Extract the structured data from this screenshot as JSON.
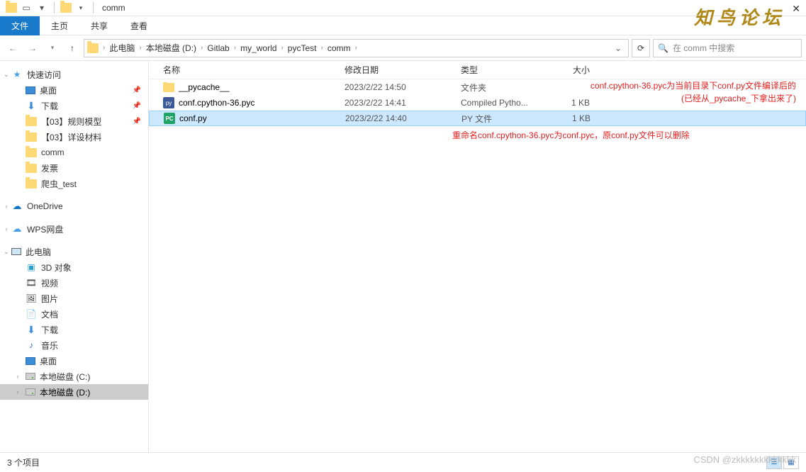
{
  "title_bar": {
    "title": "comm"
  },
  "ribbon": {
    "file": "文件",
    "tabs": [
      "主页",
      "共享",
      "查看"
    ]
  },
  "breadcrumb": {
    "items": [
      "此电脑",
      "本地磁盘 (D:)",
      "Gitlab",
      "my_world",
      "pycTest",
      "comm"
    ]
  },
  "search": {
    "placeholder": "在 comm 中搜索"
  },
  "sidebar": {
    "quick": {
      "label": "快速访问",
      "items": [
        {
          "label": "桌面",
          "pinned": true,
          "icon": "desktop"
        },
        {
          "label": "下载",
          "pinned": true,
          "icon": "down"
        },
        {
          "label": "【03】规则模型",
          "pinned": true,
          "icon": "folder"
        },
        {
          "label": "【03】详设材料",
          "pinned": false,
          "icon": "folder"
        },
        {
          "label": "comm",
          "pinned": false,
          "icon": "folder"
        },
        {
          "label": "发票",
          "pinned": false,
          "icon": "folder"
        },
        {
          "label": "爬虫_test",
          "pinned": false,
          "icon": "folder"
        }
      ]
    },
    "onedrive": "OneDrive",
    "wps": "WPS网盘",
    "thispc": {
      "label": "此电脑",
      "items": [
        {
          "label": "3D 对象",
          "icon": "3d"
        },
        {
          "label": "视频",
          "icon": "video"
        },
        {
          "label": "图片",
          "icon": "pic"
        },
        {
          "label": "文档",
          "icon": "doc"
        },
        {
          "label": "下载",
          "icon": "down"
        },
        {
          "label": "音乐",
          "icon": "music"
        },
        {
          "label": "桌面",
          "icon": "desktop"
        },
        {
          "label": "本地磁盘 (C:)",
          "icon": "drive"
        },
        {
          "label": "本地磁盘 (D:)",
          "icon": "drive",
          "selected": true
        }
      ]
    }
  },
  "columns": {
    "name": "名称",
    "date": "修改日期",
    "type": "类型",
    "size": "大小"
  },
  "files": [
    {
      "name": "__pycache__",
      "date": "2023/2/22 14:50",
      "type": "文件夹",
      "size": "",
      "icon": "folder"
    },
    {
      "name": "conf.cpython-36.pyc",
      "date": "2023/2/22 14:41",
      "type": "Compiled Pytho...",
      "size": "1 KB",
      "icon": "pyc"
    },
    {
      "name": "conf.py",
      "date": "2023/2/22 14:40",
      "type": "PY 文件",
      "size": "1 KB",
      "icon": "py",
      "selected": true
    }
  ],
  "annotations": {
    "a1_line1": "conf.cpython-36.pyc为当前目录下conf.py文件编译后的",
    "a1_line2": "(已经从_pycache_下拿出来了)",
    "a2": "重命名conf.cpython-36.pyc为conf.pyc，原conf.py文件可以删除"
  },
  "status": {
    "count": "3 个项目"
  },
  "watermark_forum": "知鸟论坛",
  "watermark_csdn": "CSDN @zkkkkkkkkkkkkk"
}
